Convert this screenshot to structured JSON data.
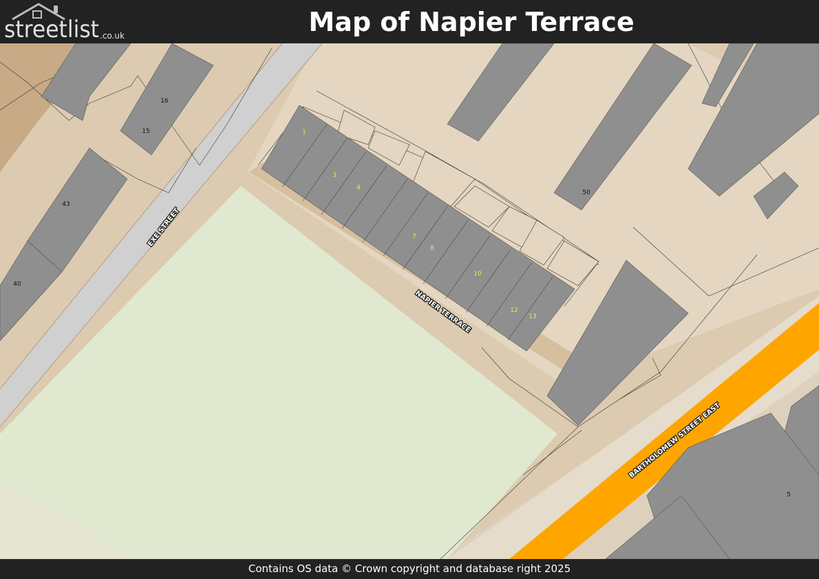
{
  "header": {
    "logo_main": "streetlist",
    "logo_suffix": ".co.uk",
    "title": "Map of Napier Terrace"
  },
  "map": {
    "street_labels": {
      "exe_street": "EXE STREET",
      "napier_terrace": "NAPIER TERRACE",
      "bartholomew_street_east": "BARTHOLOMEW STREET EAST"
    },
    "house_numbers": {
      "n1": "1",
      "n3": "3",
      "n4": "4",
      "n7": "7",
      "n8": "8",
      "n10": "10",
      "n12": "12",
      "n13": "13",
      "n15": "15",
      "n16": "16",
      "n40": "40",
      "n43": "43",
      "n50": "50",
      "n5": "5"
    },
    "colors": {
      "highlight_house_number": "#e8e85a",
      "main_road": "#ffa500",
      "building": "#8f8f8f",
      "green_space": "#e1e8d2"
    }
  },
  "footer": {
    "attribution": "Contains OS data © Crown copyright and database right 2025"
  }
}
